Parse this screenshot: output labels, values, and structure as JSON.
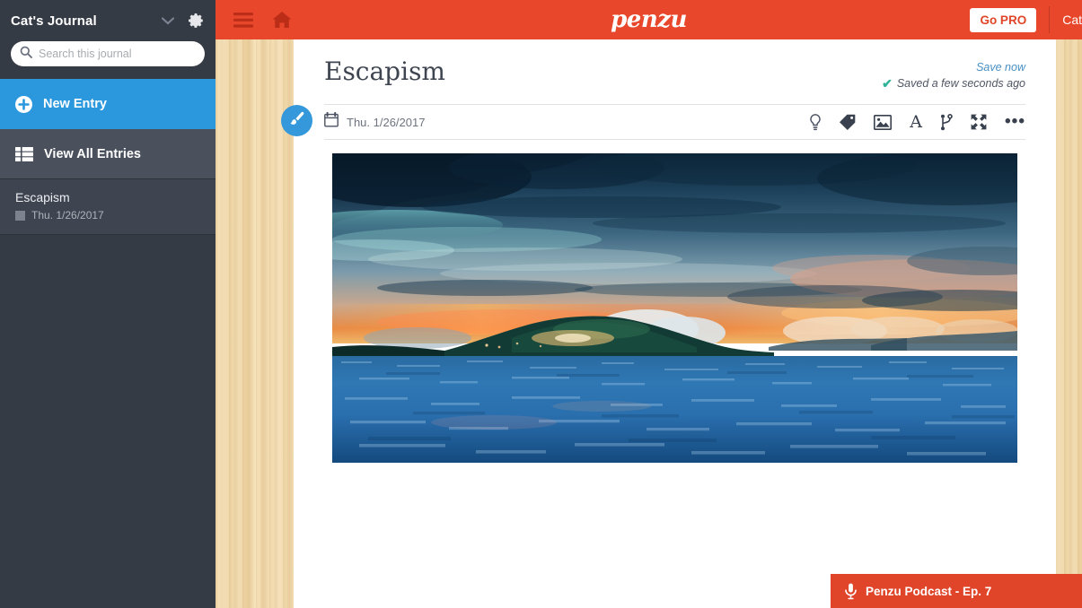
{
  "sidebar": {
    "journal_title": "Cat's Journal",
    "chevron_icon": "chevron-down-icon",
    "settings_icon": "gear-icon",
    "search": {
      "icon": "search-icon",
      "value": "",
      "placeholder": "Search this journal"
    },
    "buttons": [
      {
        "label": "New Entry",
        "icon": "plus-circle-icon",
        "active": true
      },
      {
        "label": "View All Entries",
        "icon": "list-icon",
        "active": false
      }
    ],
    "entries": [
      {
        "title": "Escapism",
        "date": "Thu. 1/26/2017",
        "selected": true
      }
    ],
    "colors": {
      "bg": "#353b45",
      "active": "#2b98dd",
      "row": "#4a515d",
      "selected_entry": "#3e4450"
    }
  },
  "topbar": {
    "menu_icon": "hamburger-icon",
    "home_icon": "home-icon",
    "logo_text": "penzu",
    "go_pro_label": "Go PRO",
    "account_name": "Cat",
    "colors": {
      "bg": "#e8472b",
      "icon": "#bc2d18",
      "go_pro_text": "#e0452a"
    }
  },
  "entry": {
    "title": "Escapism",
    "save_now_label": "Save now",
    "saved_status": "Saved a few seconds ago",
    "check_icon": "check-icon",
    "date": "Thu. 1/26/2017",
    "calendar_icon": "calendar-icon",
    "brush_icon": "paintbrush-icon",
    "toolbar": [
      {
        "name": "lightbulb-icon",
        "label": "Inspiration"
      },
      {
        "name": "tag-icon",
        "label": "Tags"
      },
      {
        "name": "image-icon",
        "label": "Insert Image"
      },
      {
        "name": "font-icon",
        "label": "A"
      },
      {
        "name": "branch-icon",
        "label": "Branch"
      },
      {
        "name": "expand-icon",
        "label": "Fullscreen"
      },
      {
        "name": "more-icon",
        "label": "•••"
      }
    ],
    "photo": {
      "alt": "Tropical island at sunset over the ocean",
      "colors": {
        "sky_top": "#13324c",
        "sky_mid": "#4d6d85",
        "sunset": "#e8803f",
        "water_light": "#3f86c4",
        "water_dark": "#123556"
      }
    }
  },
  "podcast": {
    "icon": "microphone-icon",
    "label": "Penzu Podcast - Ep. 7",
    "color": "#e0452a"
  }
}
